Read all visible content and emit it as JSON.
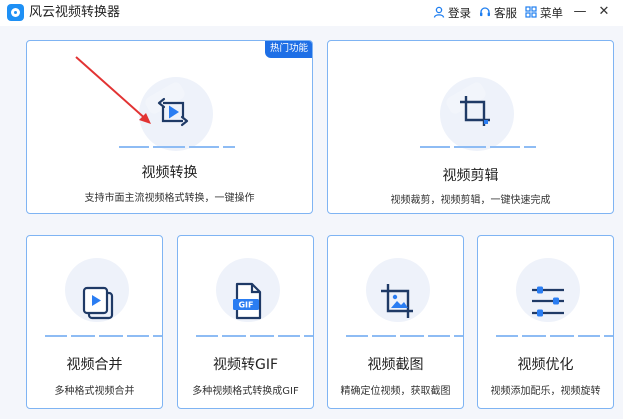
{
  "app": {
    "title": "风云视频转换器"
  },
  "titlebar": {
    "login_label": "登录",
    "service_label": "客服",
    "menu_label": "菜单",
    "minimize": "—",
    "close": "✕"
  },
  "cards": {
    "convert": {
      "title": "视频转换",
      "desc": "支持市面主流视频格式转换，一键操作",
      "badge": "热门功能"
    },
    "edit": {
      "title": "视频剪辑",
      "desc": "视频裁剪，视频剪辑，一键快速完成"
    },
    "merge": {
      "title": "视频合并",
      "desc": "多种格式视频合并"
    },
    "gif": {
      "title": "视频转GIF",
      "desc": "多种视频格式转换成GIF",
      "icon_text": "GIF"
    },
    "screenshot": {
      "title": "视频截图",
      "desc": "精确定位视频，获取截图"
    },
    "optimize": {
      "title": "视频优化",
      "desc": "视频添加配乐，视频旋转"
    }
  },
  "colors": {
    "accent": "#1e6fe6",
    "icon": "#1f3a66",
    "play": "#2a7df2",
    "arrow": "#e23333"
  }
}
